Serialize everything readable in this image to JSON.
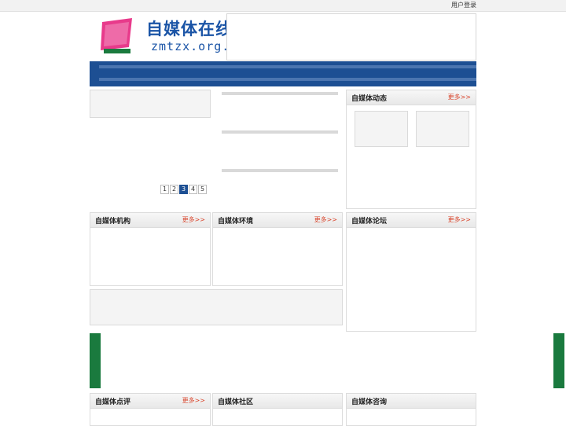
{
  "header": {
    "site_title": "自媒体在线网",
    "domain": "zmtzx.org.cn",
    "login_link": "用户登录"
  },
  "pager": {
    "pages": [
      "1",
      "2",
      "3",
      "4",
      "5"
    ]
  },
  "sections": {
    "media_news": {
      "title": "自媒体动态",
      "more": "更多>>"
    },
    "institutions": {
      "title": "自媒体机构",
      "more": "更多>>"
    },
    "environment": {
      "title": "自媒体环境",
      "more": "更多>>"
    },
    "forum": {
      "title": "自媒体论坛",
      "more": "更多>>"
    },
    "ratings": {
      "title": "自媒体点评",
      "more": "更多>>"
    },
    "community": {
      "title": "自媒体社区"
    },
    "consulting": {
      "title": "自媒体咨询"
    }
  },
  "colors": {
    "nav_bg": "#1d4f93",
    "more_link": "#d9442b",
    "accent_green": "#1a7a3e",
    "brand_blue": "#1a54a6"
  }
}
